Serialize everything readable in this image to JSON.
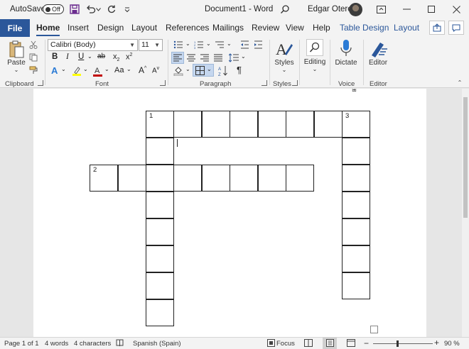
{
  "titlebar": {
    "autosave_label": "AutoSave",
    "autosave_state": "Off",
    "document_title": "Document1 - Word",
    "user_name": "Edgar Otero"
  },
  "tabs": {
    "file": "File",
    "items": [
      "Home",
      "Insert",
      "Design",
      "Layout",
      "References",
      "Mailings",
      "Review",
      "View",
      "Help",
      "Table Design",
      "Layout"
    ]
  },
  "ribbon": {
    "clipboard": {
      "paste": "Paste",
      "label": "Clipboard"
    },
    "font": {
      "name": "Calibri (Body)",
      "size": "11",
      "label": "Font"
    },
    "paragraph": {
      "label": "Paragraph"
    },
    "styles": {
      "button": "Styles",
      "label": "Styles"
    },
    "editing": {
      "button": "Editing"
    },
    "voice": {
      "button": "Dictate",
      "label": "Voice"
    },
    "editor": {
      "button": "Editor",
      "label": "Editor"
    }
  },
  "crossword": {
    "clue_numbers": [
      "1",
      "2",
      "3"
    ]
  },
  "statusbar": {
    "page": "Page 1 of 1",
    "words": "4 words",
    "characters": "4 characters",
    "language": "Spanish (Spain)",
    "focus": "Focus",
    "zoom": "90 %"
  },
  "colors": {
    "accent": "#2b579a",
    "highlight": "#ffff00",
    "font_color": "#c00000"
  }
}
